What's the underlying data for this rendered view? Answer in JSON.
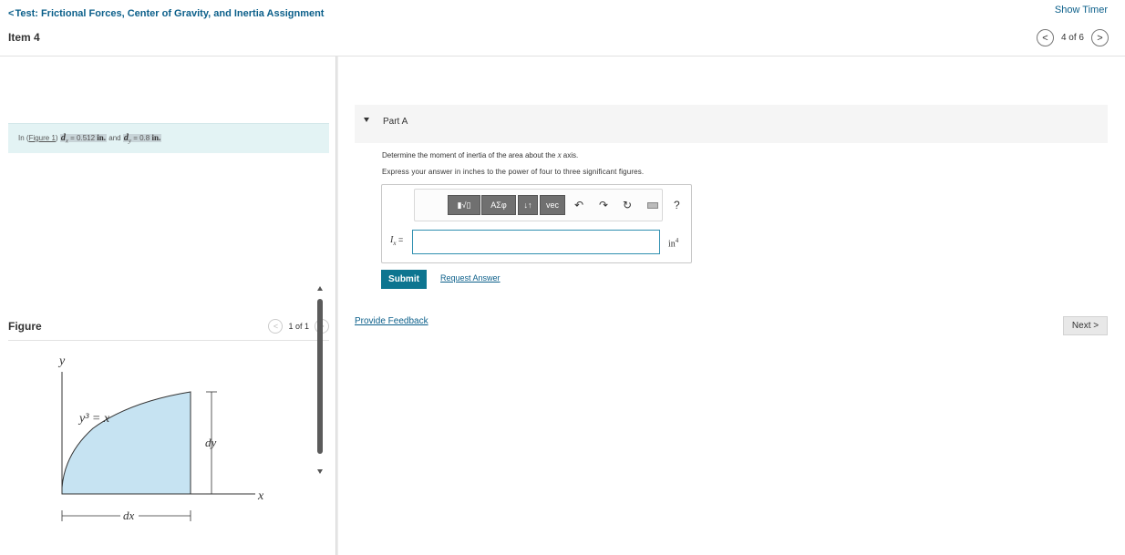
{
  "header": {
    "back_chevron": "<",
    "back_link": "Test: Frictional Forces, Center of Gravity, and Inertia Assignment",
    "item_title": "Item 4",
    "show_timer": "Show Timer",
    "prev_icon": "<",
    "next_icon": ">",
    "pager_text": "4 of 6"
  },
  "given": {
    "prefix": "In (",
    "figure_link": "Figure 1",
    "after_link": ")",
    "dx_symbol": "d",
    "dx_sub": "x",
    "dx_value": " = 0.512 ",
    "dx_unit": "in.",
    "mid": " and ",
    "dy_symbol": "d",
    "dy_sub": "y",
    "dy_value": " = 0.8 ",
    "dy_unit": "in."
  },
  "figure": {
    "title": "Figure",
    "pager_text": "1 of 1",
    "prev_icon": "<",
    "next_icon": ">",
    "y_axis": "y",
    "x_axis": "x",
    "curve_label": "y³ = x",
    "dy_label": "dy",
    "dx_label": "dx",
    "fill_color": "#c6e3f2"
  },
  "part": {
    "label": "Part A",
    "question_pre": "Determine the moment of inertia of the area about the ",
    "question_axis": "x",
    "question_post": " axis.",
    "instruction": "Express your answer in inches to the power of four to three significant figures.",
    "toolbar": {
      "template_btn": "▮√▯",
      "greek_btn": "ΑΣφ",
      "arrows_btn": "↓↑",
      "vec_btn": "vec",
      "undo_icon": "↶",
      "redo_icon": "↷",
      "reset_icon": "↻",
      "help_icon": "?"
    },
    "var_symbol": "I",
    "var_sub": "x",
    "var_eq": " =",
    "answer_value": "",
    "unit": "in",
    "unit_exp": "4",
    "submit": "Submit",
    "request": "Request Answer"
  },
  "footer": {
    "feedback": "Provide Feedback",
    "next": "Next",
    "next_chevron": ">"
  },
  "colors": {
    "link": "#0b5f8a",
    "submit_bg": "#0d7590",
    "given_bg": "#e3f3f4",
    "input_border": "#2f8fb0"
  }
}
